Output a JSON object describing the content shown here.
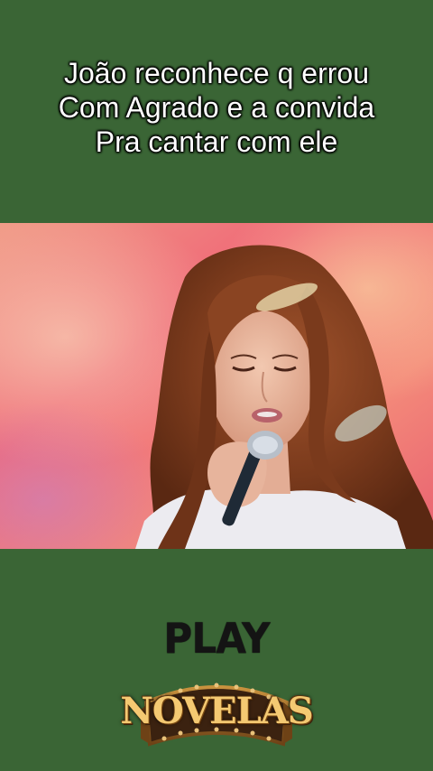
{
  "caption": {
    "lines": [
      "João reconhece q errou",
      "Com Agrado e a convida",
      "Pra cantar com ele"
    ]
  },
  "video": {
    "description_icon": "singer-frame"
  },
  "logo": {
    "play": "PLAY",
    "novelas": "NOVELAS"
  },
  "colors": {
    "background": "#3a6535",
    "caption_text": "#ffffff",
    "logo_gold": "#f4c972"
  }
}
